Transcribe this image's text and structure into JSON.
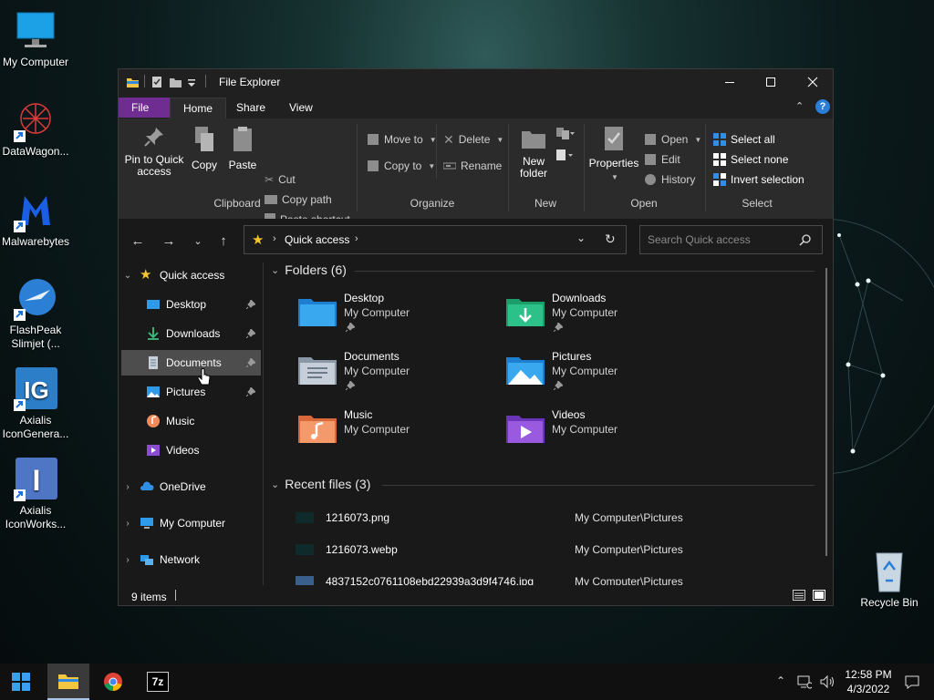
{
  "desktop": {
    "icons": [
      {
        "label": "My Computer"
      },
      {
        "label": "DataWagon..."
      },
      {
        "label": "Malwarebytes"
      },
      {
        "label": "FlashPeak Slimjet (..."
      },
      {
        "label": "Axialis IconGenera..."
      },
      {
        "label": "Axialis IconWorks..."
      },
      {
        "label": "Recycle Bin"
      }
    ]
  },
  "window": {
    "title": "File Explorer",
    "tabs": [
      "File",
      "Home",
      "Share",
      "View"
    ]
  },
  "ribbon": {
    "clipboard": {
      "pin": "Pin to Quick access",
      "copy": "Copy",
      "paste": "Paste",
      "cut": "Cut",
      "copy_path": "Copy path",
      "paste_shortcut": "Paste shortcut",
      "label": "Clipboard"
    },
    "organize": {
      "move_to": "Move to",
      "copy_to": "Copy to",
      "delete": "Delete",
      "rename": "Rename",
      "label": "Organize"
    },
    "new": {
      "new_folder": "New folder",
      "label": "New"
    },
    "open": {
      "properties": "Properties",
      "open": "Open",
      "edit": "Edit",
      "history": "History",
      "label": "Open"
    },
    "select": {
      "select_all": "Select all",
      "select_none": "Select none",
      "invert": "Invert selection",
      "label": "Select"
    }
  },
  "address": {
    "path": "Quick access",
    "search_placeholder": "Search Quick access"
  },
  "nav": {
    "quick_access": "Quick access",
    "items": [
      "Desktop",
      "Downloads",
      "Documents",
      "Pictures",
      "Music",
      "Videos"
    ],
    "onedrive": "OneDrive",
    "my_computer": "My Computer",
    "network": "Network"
  },
  "content": {
    "folders_header": "Folders (6)",
    "folders": [
      {
        "name": "Desktop",
        "location": "My Computer"
      },
      {
        "name": "Downloads",
        "location": "My Computer"
      },
      {
        "name": "Documents",
        "location": "My Computer"
      },
      {
        "name": "Pictures",
        "location": "My Computer"
      },
      {
        "name": "Music",
        "location": "My Computer"
      },
      {
        "name": "Videos",
        "location": "My Computer"
      }
    ],
    "recent_header": "Recent files (3)",
    "recent": [
      {
        "name": "1216073.png",
        "location": "My Computer\\Pictures"
      },
      {
        "name": "1216073.webp",
        "location": "My Computer\\Pictures"
      },
      {
        "name": "4837152c0761108ebd22939a3d9f4746.jpg",
        "location": "My Computer\\Pictures"
      }
    ]
  },
  "status": {
    "items": "9 items"
  },
  "taskbar": {
    "time": "12:58 PM",
    "date": "4/3/2022",
    "seven_zip": "7z"
  },
  "colors": {
    "file_tab": "#6f2c91",
    "select_icon": "#2f8fe6",
    "folder_blue": "#2f9be8"
  }
}
